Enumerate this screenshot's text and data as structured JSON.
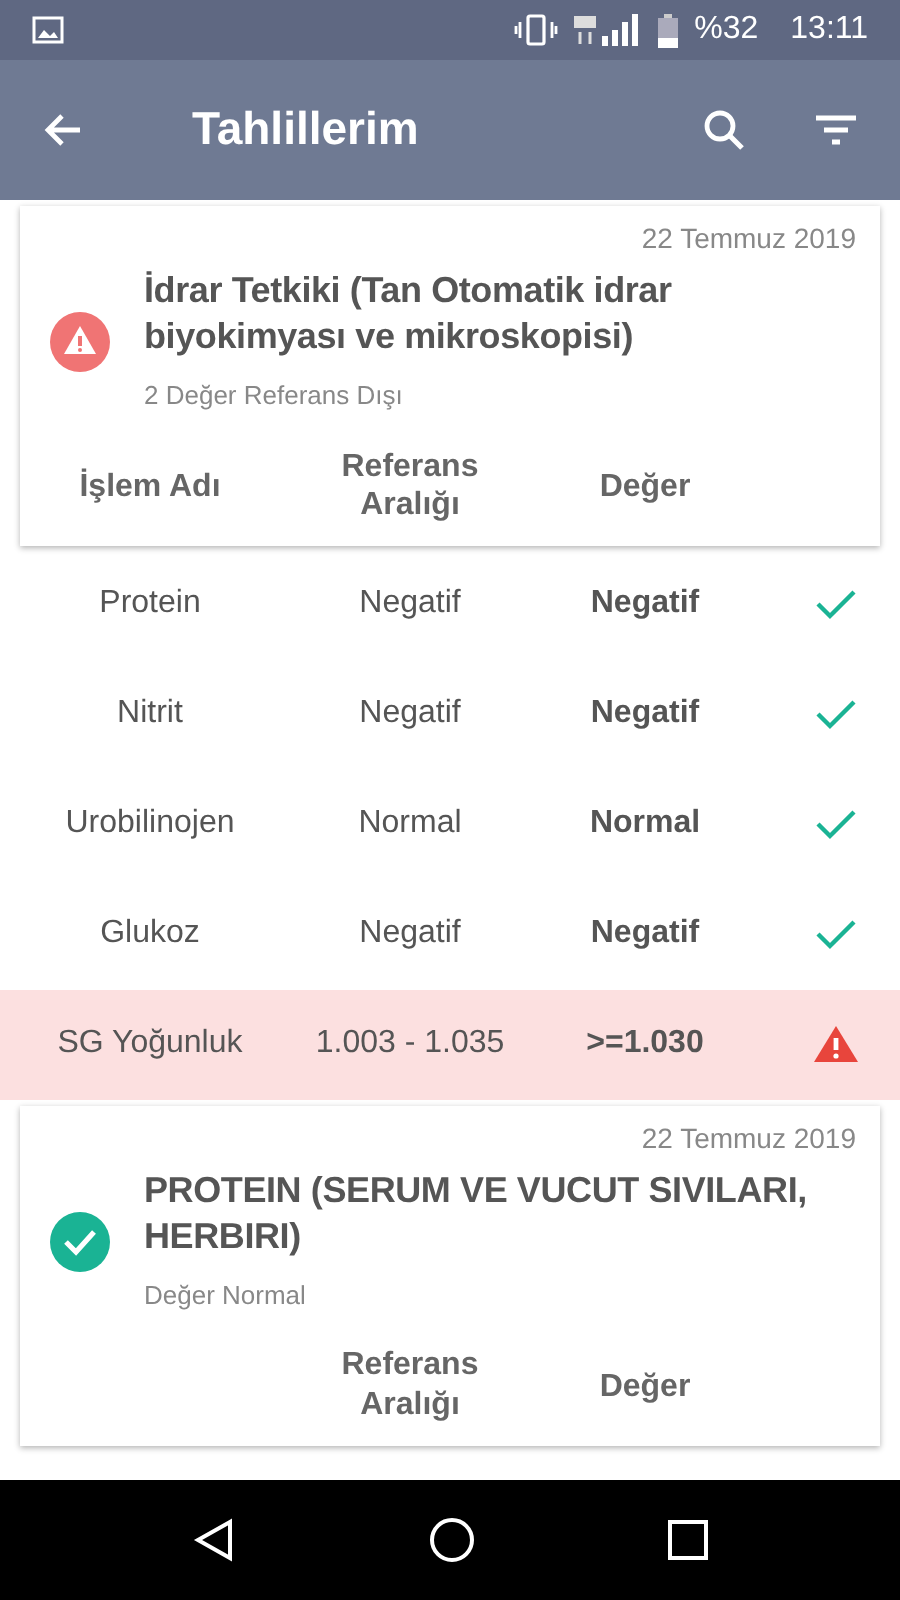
{
  "status_bar": {
    "battery": "%32",
    "time": "13:11"
  },
  "app_bar": {
    "title": "Tahlillerim"
  },
  "tests": [
    {
      "date": "22 Temmuz 2019",
      "title": "İdrar Tetkiki (Tan Otomatik idrar biyokimyası ve mikroskopisi)",
      "summary": "2 Değer Referans Dışı",
      "out_of_range": true,
      "name_column": "İşlem Adı",
      "range_column": "Referans Aralığı",
      "value_column": "Değer",
      "rows": [
        {
          "name": "Protein",
          "range": "Negatif",
          "value": "Negatif",
          "out_of_range": false
        },
        {
          "name": "Nitrit",
          "range": "Negatif",
          "value": "Negatif",
          "out_of_range": false
        },
        {
          "name": "Urobilinojen",
          "range": "Normal",
          "value": "Normal",
          "out_of_range": false
        },
        {
          "name": "Glukoz",
          "range": "Negatif",
          "value": "Negatif",
          "out_of_range": false
        },
        {
          "name": "SG Yoğunluk",
          "range": "1.003 - 1.035",
          "value": ">=1.030",
          "out_of_range": true
        }
      ]
    },
    {
      "date": "22 Temmuz 2019",
      "title": "PROTEIN (SERUM VE VUCUT SIVILARI, HERBIRI)",
      "summary": "Değer Normal",
      "out_of_range": false,
      "range_column": "Referans Aralığı",
      "value_column": "Değer"
    }
  ]
}
